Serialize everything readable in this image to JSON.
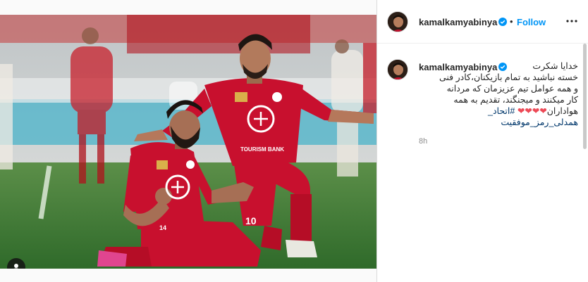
{
  "post": {
    "username": "kamalkamyabinya",
    "follow_label": "Follow",
    "separator": "•",
    "verified_icon": "verified-badge-icon",
    "more_icon": "more-options-icon",
    "user_tag_icon": "user-tag-icon"
  },
  "caption": {
    "username": "kamalkamyabinya",
    "line1": "خدایا شکرت",
    "line2": "خسته نباشید به تمام بازیکنان،کادر فنی",
    "line3": "و همه عوامل تیم عزیزمان که مردانه",
    "line4": "کار میکنند و میجنگند، تقدیم به همه",
    "line5_text": "هواداران",
    "line5_hearts": "❤❤❤❤",
    "line5_hashtag": "#اتحاد_",
    "line6": "همدلی_رمز_موفقیت",
    "time": "8h"
  },
  "photo": {
    "sponsor_text": "TOURISM BANK",
    "jersey_number_front": "10",
    "jersey_number_kneel": "14"
  },
  "colors": {
    "link_blue": "#0095f6",
    "text_dark": "#262626",
    "muted": "#8e8e8e",
    "jersey_red": "#c8102e",
    "pitch_green": "#3f7a34"
  }
}
